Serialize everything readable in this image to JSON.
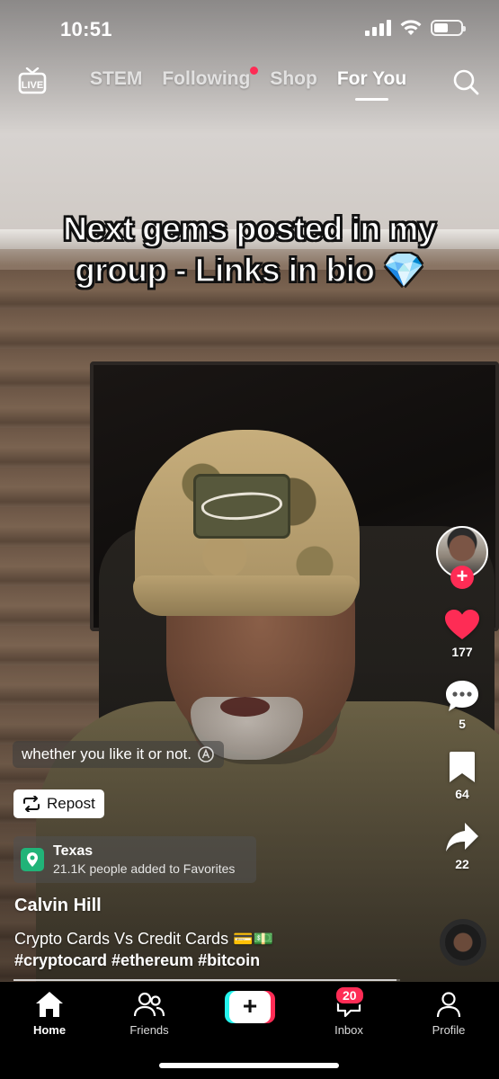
{
  "status_bar": {
    "time": "10:51",
    "battery_level": 0.55
  },
  "top_nav": {
    "live_label": "LIVE",
    "tabs": [
      {
        "label": "STEM",
        "active": false,
        "dot": false
      },
      {
        "label": "Following",
        "active": false,
        "dot": true
      },
      {
        "label": "Shop",
        "active": false,
        "dot": false
      },
      {
        "label": "For You",
        "active": true,
        "dot": false
      }
    ],
    "search_icon": "search-icon"
  },
  "video": {
    "overlay_caption": "Next gems posted in my group - Links in bio 💎",
    "subtitle": "whether you like it or not."
  },
  "actions": {
    "likes": "177",
    "comments": "5",
    "bookmarks": "64",
    "shares": "22",
    "colors": {
      "like": "#fe2c55",
      "follow": "#fe2c55"
    }
  },
  "post": {
    "repost_label": "Repost",
    "location": {
      "name": "Texas",
      "sub": "21.1K people added to Favorites"
    },
    "author": "Calvin Hill",
    "description": "Crypto Cards Vs Credit Cards 💳💵",
    "hashtags": "#cryptocard #ethereum #bitcoin",
    "progress": 0.99
  },
  "tab_bar": {
    "home": "Home",
    "friends": "Friends",
    "inbox": "Inbox",
    "inbox_badge": "20",
    "profile": "Profile"
  }
}
